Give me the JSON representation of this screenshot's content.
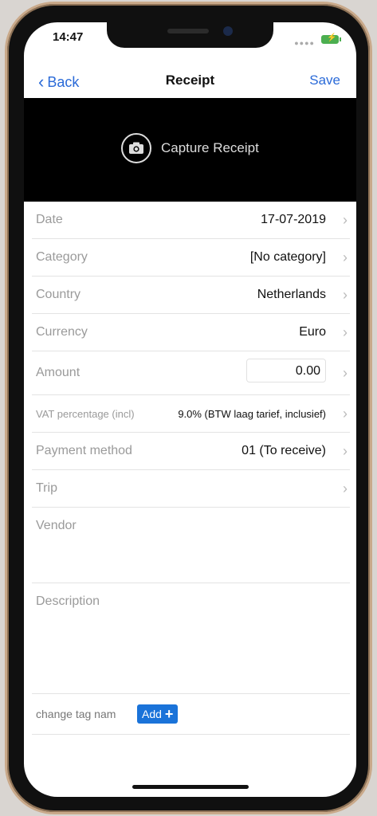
{
  "status": {
    "time": "14:47"
  },
  "nav": {
    "back_label": "Back",
    "title": "Receipt",
    "save_label": "Save"
  },
  "capture": {
    "label": "Capture Receipt"
  },
  "fields": {
    "date": {
      "label": "Date",
      "value": "17-07-2019"
    },
    "category": {
      "label": "Category",
      "value": "[No category]"
    },
    "country": {
      "label": "Country",
      "value": "Netherlands"
    },
    "currency": {
      "label": "Currency",
      "value": "Euro"
    },
    "amount": {
      "label": "Amount",
      "value": "0.00"
    },
    "vat": {
      "label": "VAT percentage (incl)",
      "value": "9.0% (BTW laag tarief, inclusief)"
    },
    "payment": {
      "label": "Payment method",
      "value": "01 (To receive)"
    },
    "trip": {
      "label": "Trip"
    },
    "vendor": {
      "label": "Vendor"
    },
    "description": {
      "label": "Description"
    }
  },
  "tags": {
    "label": "change tag nam",
    "add_label": "Add",
    "add_icon": "+"
  },
  "colors": {
    "accent": "#2a6ad8",
    "add_button": "#1a73d9",
    "battery": "#4caf50"
  }
}
